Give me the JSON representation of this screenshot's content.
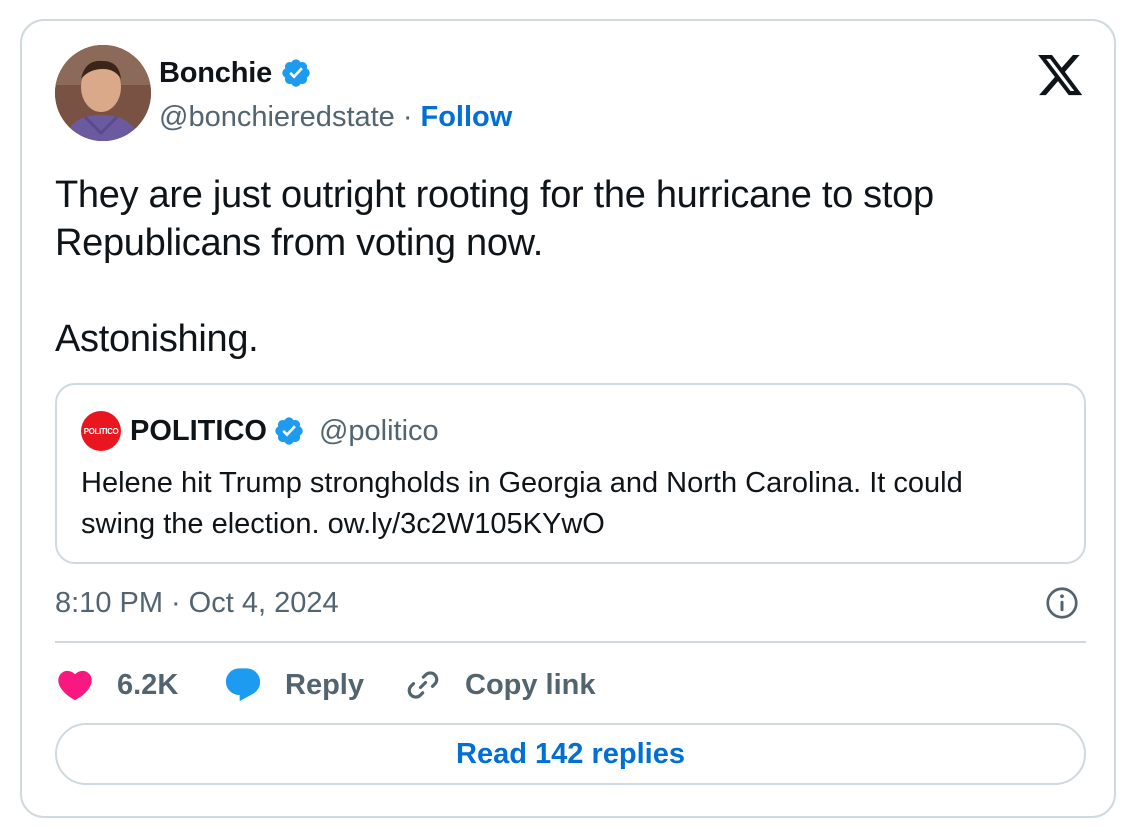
{
  "tweet": {
    "author": {
      "name": "Bonchie",
      "handle": "@bonchieredstate",
      "separator": "·",
      "follow_label": "Follow"
    },
    "text_line1": "They are just outright rooting for the hurricane to stop Republicans from voting now.",
    "text_line2": "Astonishing.",
    "quote": {
      "logo_text": "POLITICO",
      "name": "POLITICO",
      "handle": "@politico",
      "text": "Helene hit Trump strongholds in Georgia and North Carolina. It could swing the election. ow.ly/3c2W105KYwO"
    },
    "time": "8:10 PM",
    "time_separator": "·",
    "date": "Oct 4, 2024",
    "actions": {
      "like_count": "6.2K",
      "reply_label": "Reply",
      "copy_label": "Copy link"
    },
    "read_replies_label": "Read 142 replies"
  },
  "colors": {
    "accent": "#006fd6",
    "verified": "#1d9bf0",
    "like": "#f91880",
    "politico_red": "#e8171f",
    "muted": "#536471",
    "border": "#cfd9de"
  },
  "icons": {
    "brand": "x-logo-icon",
    "verified": "verified-badge-icon",
    "info": "info-icon",
    "like": "heart-icon",
    "reply": "speech-bubble-icon",
    "copy": "link-icon"
  }
}
